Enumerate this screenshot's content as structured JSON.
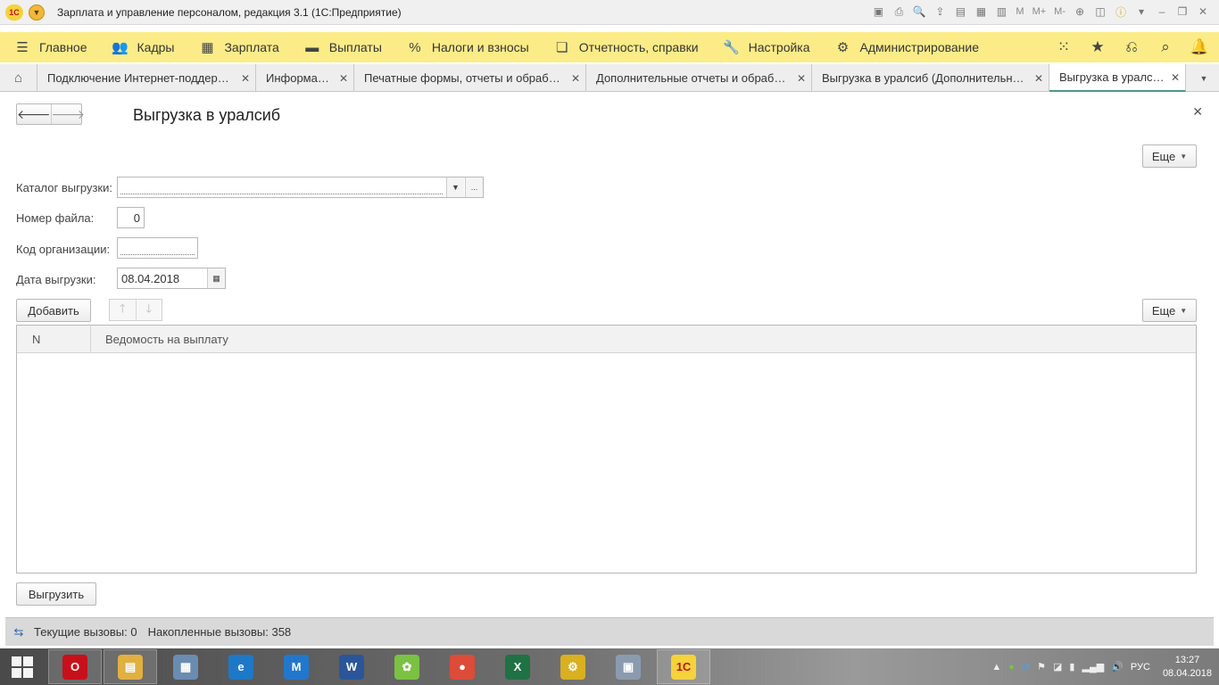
{
  "window": {
    "title": "Зарплата и управление персоналом, редакция 3.1  (1С:Предприятие)",
    "logo_text": "1С",
    "toolbar_m_labels": [
      "M",
      "M+",
      "M-"
    ]
  },
  "sections": [
    {
      "label": "Главное",
      "icon": "menu-icon"
    },
    {
      "label": "Кадры",
      "icon": "people-icon"
    },
    {
      "label": "Зарплата",
      "icon": "calculator-icon"
    },
    {
      "label": "Выплаты",
      "icon": "wallet-icon"
    },
    {
      "label": "Налоги и взносы",
      "icon": "percent-icon"
    },
    {
      "label": "Отчетность, справки",
      "icon": "documents-icon"
    },
    {
      "label": "Настройка",
      "icon": "wrench-icon"
    },
    {
      "label": "Администрирование",
      "icon": "gear-icon"
    }
  ],
  "tabs": [
    {
      "label": "Подключение Интернет-поддержки"
    },
    {
      "label": "Информация"
    },
    {
      "label": "Печатные формы, отчеты и обработки"
    },
    {
      "label": "Дополнительные отчеты и обработки"
    },
    {
      "label": "Выгрузка в уралсиб  (Дополнительная обработка)"
    },
    {
      "label": "Выгрузка в уралсиб",
      "active": true
    }
  ],
  "form": {
    "title": "Выгрузка в уралсиб",
    "more_label": "Еще",
    "fields": {
      "catalog": {
        "label": "Каталог выгрузки:",
        "value": "",
        "select_glyph": "..."
      },
      "file_number": {
        "label": "Номер файла:",
        "value": "0"
      },
      "org_code": {
        "label": "Код организации:",
        "value": ""
      },
      "export_date": {
        "label": "Дата выгрузки:",
        "value": "08.04.2018"
      }
    },
    "add_button": "Добавить",
    "table_more_label": "Еще",
    "table": {
      "columns": [
        "N",
        "Ведомость на выплату"
      ],
      "rows": []
    },
    "export_button": "Выгрузить"
  },
  "status_bar": {
    "current_calls_label": "Текущие вызовы:",
    "current_calls_value": "0",
    "accumulated_calls_label": "Накопленные вызовы:",
    "accumulated_calls_value": "358"
  },
  "taskbar": {
    "apps": [
      {
        "name": "Opera",
        "color": "#c8101b",
        "glyph": "O"
      },
      {
        "name": "File Explorer",
        "color": "#e0b040",
        "glyph": "▤"
      },
      {
        "name": "Calculator",
        "color": "#6a8cb0",
        "glyph": "▦"
      },
      {
        "name": "Internet Explorer",
        "color": "#1e78c8",
        "glyph": "e"
      },
      {
        "name": "Maxthon",
        "color": "#2277cc",
        "glyph": "M"
      },
      {
        "name": "Word",
        "color": "#2a5699",
        "glyph": "W"
      },
      {
        "name": "ICQ",
        "color": "#7bc142",
        "glyph": "✿"
      },
      {
        "name": "Chrome",
        "color": "#dd4b39",
        "glyph": "●"
      },
      {
        "name": "Excel",
        "color": "#1f7244",
        "glyph": "X"
      },
      {
        "name": "1C Configurator",
        "color": "#d8b020",
        "glyph": "⚙"
      },
      {
        "name": "Performance Monitor",
        "color": "#8a9bb0",
        "glyph": "▣"
      },
      {
        "name": "1C Enterprise",
        "color": "#f5d33b",
        "glyph": "1С"
      }
    ],
    "language": "РУС",
    "time": "13:27",
    "date": "08.04.2018"
  }
}
